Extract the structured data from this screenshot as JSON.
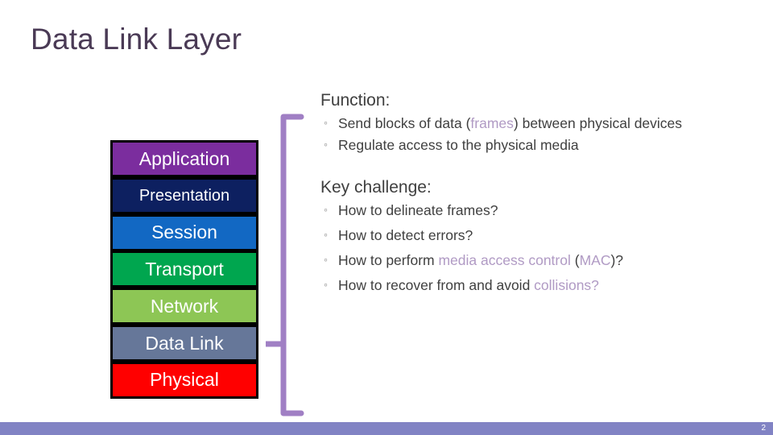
{
  "slide": {
    "title": "Data Link Layer",
    "title_color": "#4a3a55",
    "page_number": "2",
    "background": "#ffffff",
    "bottom_bar_color": "#8183c4",
    "highlight_color": "#b09ac4",
    "brace_color": "#a07fc4"
  },
  "osi_stack": {
    "border_color": "#000000",
    "layers": [
      {
        "label": "Application",
        "color": "#7b2d9e",
        "text_color": "#ffffff",
        "size": "normal"
      },
      {
        "label": "Presentation",
        "color": "#0d2060",
        "text_color": "#ffffff",
        "size": "small"
      },
      {
        "label": "Session",
        "color": "#1268c3",
        "text_color": "#ffffff",
        "size": "normal"
      },
      {
        "label": "Transport",
        "color": "#00a64f",
        "text_color": "#ffffff",
        "size": "normal"
      },
      {
        "label": "Network",
        "color": "#8dc655",
        "text_color": "#ffffff",
        "size": "normal"
      },
      {
        "label": "Data Link",
        "color": "#667799",
        "text_color": "#ffffff",
        "size": "normal"
      },
      {
        "label": "Physical",
        "color": "#ff0000",
        "text_color": "#ffffff",
        "size": "normal"
      }
    ]
  },
  "content": {
    "function_heading": "Function:",
    "function_bullets": [
      {
        "pre": "Send blocks of data (",
        "highlight": "frames",
        "post": ") between physical devices"
      },
      {
        "pre": "Regulate access to the physical media",
        "highlight": "",
        "post": ""
      }
    ],
    "challenge_heading": "Key challenge:",
    "challenge_bullets": [
      {
        "pre": "How to delineate frames?",
        "highlight": "",
        "post": ""
      },
      {
        "pre": "How to detect errors?",
        "highlight": "",
        "post": ""
      },
      {
        "pre": "How to perform ",
        "highlight": "media access control",
        "post": " (",
        "highlight2": "MAC",
        "post2": ")?"
      },
      {
        "pre": "How to recover from and avoid ",
        "highlight": "collisions?",
        "post": ""
      }
    ],
    "bullet_glyph": "◦"
  }
}
